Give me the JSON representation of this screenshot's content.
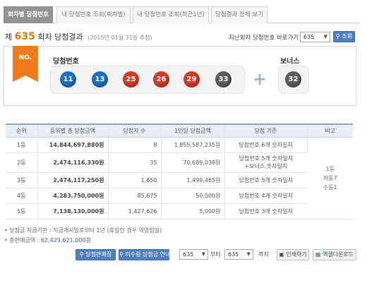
{
  "tabs": [
    "회차별 당첨번호",
    "내 당첨번호 조회(회차별)",
    "내 당첨번호 조회(최근1년)",
    "당첨결과 전체 보기"
  ],
  "header": {
    "prefix": "제",
    "round": "635",
    "suffix": "회차 당첨결과",
    "date": "(2015년 01월 31일 추첨)",
    "goto_label": "지난회차 당첨번호 바로가기",
    "goto_value": "635",
    "search_label": "조회"
  },
  "result": {
    "badge": "NO.",
    "win_label": "당첨번호",
    "bonus_label": "보너스",
    "plus": "+",
    "numbers": [
      "11",
      "13",
      "25",
      "26",
      "29",
      "33"
    ],
    "colors": [
      "#1f6fc6",
      "#1f6fc6",
      "#d83a2a",
      "#d83a2a",
      "#d83a2a",
      "#5d5d5d"
    ],
    "bonus": "32",
    "bonus_color": "#5d5d5d"
  },
  "table": {
    "headers": [
      "순위",
      "등위별 총 당첨금액",
      "당첨자 수",
      "1인당 당첨금액",
      "당첨 기준",
      "비고"
    ],
    "rows": [
      {
        "rank": "1등",
        "total": "14,844,697,880원",
        "winners": "8",
        "per": "1,855,587,235원",
        "crit": "당첨번호 6개 숫자일치"
      },
      {
        "rank": "2등",
        "total": "2,474,116,330원",
        "winners": "35",
        "per": "70,689,038원",
        "crit": "당첨번호 5개 숫자일치",
        "crit2": "+보너스 숫자일치"
      },
      {
        "rank": "3등",
        "total": "2,474,117,250원",
        "winners": "1,650",
        "per": "1,499,465원",
        "crit": "당첨번호 5개 숫자일치"
      },
      {
        "rank": "4등",
        "total": "4,283,750,000원",
        "winners": "85,675",
        "per": "50,000원",
        "crit": "당첨번호 4개 숫자일치"
      },
      {
        "rank": "5등",
        "total": "7,138,130,000원",
        "winners": "1,427,626",
        "per": "5,000원",
        "crit": "당첨번호 3개 숫자일치"
      }
    ],
    "note": [
      "1등",
      "자동7",
      "수동1"
    ]
  },
  "info": {
    "deadline_label": "• 당첨금 지급기한 : 지급개시일로부터 1년 (휴일인 경우 익영업일)",
    "total_label": "• 총판매금액 : ",
    "total_value": "62,429,621,000원"
  },
  "bottom": {
    "store_btn": "당첨판매점",
    "lookup_btn": "미수령 당첨금 안내",
    "from_value": "635",
    "from_label": "부터",
    "to_value": "635",
    "to_label": "까지",
    "print_btn": "인쇄하기",
    "excel_btn": "엑셀다운로드"
  }
}
